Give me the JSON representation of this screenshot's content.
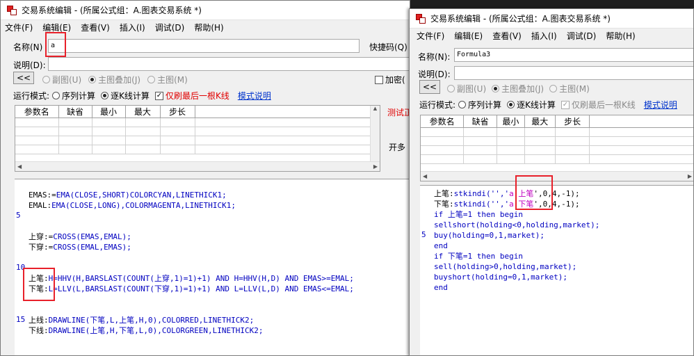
{
  "left_window": {
    "title": "交易系统编辑 - (所属公式组：A.图表交易系统 *)",
    "menu": [
      "文件(F)",
      "编辑(E)",
      "查看(V)",
      "插入(I)",
      "调试(D)",
      "帮助(H)"
    ],
    "name_label": "名称(N)",
    "name_value": "a",
    "shortcut_label": "快捷码(Q)",
    "desc_label": "说明(D):",
    "collapse_btn": "<<",
    "radios": [
      "副图(U)",
      "主图叠加(J)",
      "主图(M)"
    ],
    "encrypt_label": "加密(",
    "run_mode_label": "运行模式:",
    "run_modes": [
      "序列计算",
      "逐K线计算"
    ],
    "last_bar_label": "仅刷最后一根K线",
    "mode_help": "模式说明",
    "param_headers": [
      "参数名",
      "缺省",
      "最小",
      "最大",
      "步长"
    ],
    "test_label": "测试正",
    "more_label": "开多",
    "line_numbers": [
      "5",
      "10",
      "15"
    ],
    "code": [
      [
        "EMAS:=",
        "EMA(CLOSE,SHORT)COLORCYAN,LINETHICK1;"
      ],
      [
        "EMAL:",
        "EMA(CLOSE,LONG),COLORMAGENTA,LINETHICK1;"
      ],
      [
        "上穿:=",
        "CROSS(EMAS,EMAL);"
      ],
      [
        "下穿:=",
        "CROSS(EMAL,EMAS);"
      ],
      [
        "上笔:",
        "H=HHV(H,BARSLAST(COUNT(上穿,1)=1)+1) AND H=HHV(H,D) AND EMAS>=EMAL;"
      ],
      [
        "下笔:",
        "L=LLV(L,BARSLAST(COUNT(下穿,1)=1)+1) AND L=LLV(L,D) AND EMAS<=EMAL;"
      ],
      [
        "上线:",
        "DRAWLINE(下笔,L,上笔,H,0),COLORRED,LINETHICK2;"
      ],
      [
        "下线:",
        "DRAWLINE(上笔,H,下笔,L,0),COLORGREEN,LINETHICK2;"
      ]
    ]
  },
  "right_window": {
    "title": "交易系统编辑 - (所属公式组：A.图表交易系统 *)",
    "menu": [
      "文件(F)",
      "编辑(E)",
      "查看(V)",
      "插入(I)",
      "调试(D)",
      "帮助(H)"
    ],
    "name_label": "名称(N):",
    "name_value": "Formula3",
    "desc_label": "说明(D):",
    "collapse_btn": "<<",
    "radios": [
      "副图(U)",
      "主图叠加(J)",
      "主图(M)"
    ],
    "run_mode_label": "运行模式:",
    "run_modes": [
      "序列计算",
      "逐K线计算"
    ],
    "last_bar_label": "仅刷最后一根K线",
    "mode_help": "模式说明",
    "param_headers": [
      "参数名",
      "缺省",
      "最小",
      "最大",
      "步长"
    ],
    "line_numbers": [
      "5"
    ],
    "code": [
      [
        "上笔:",
        "stkindi('','",
        "a.上笔",
        "',0,4,-1);"
      ],
      [
        "下笔:",
        "stkindi('','",
        "a.下笔",
        "',0,4,-1);"
      ],
      [
        "if 上笔=1 then begin"
      ],
      [
        "sellshort(holding<0,holding,market);"
      ],
      [
        "buy(holding=0,1,market);"
      ],
      [
        "end"
      ],
      [
        "if 下笔=1 then begin"
      ],
      [
        "sell(holding>0,holding,market);"
      ],
      [
        "buyshort(holding=0,1,market);"
      ],
      [
        "end"
      ]
    ]
  },
  "colors": {
    "highlight": "#e8202a",
    "keyword": "#0000c0",
    "string": "#c000c0",
    "link": "#0033cc",
    "warning": "#e00000"
  }
}
